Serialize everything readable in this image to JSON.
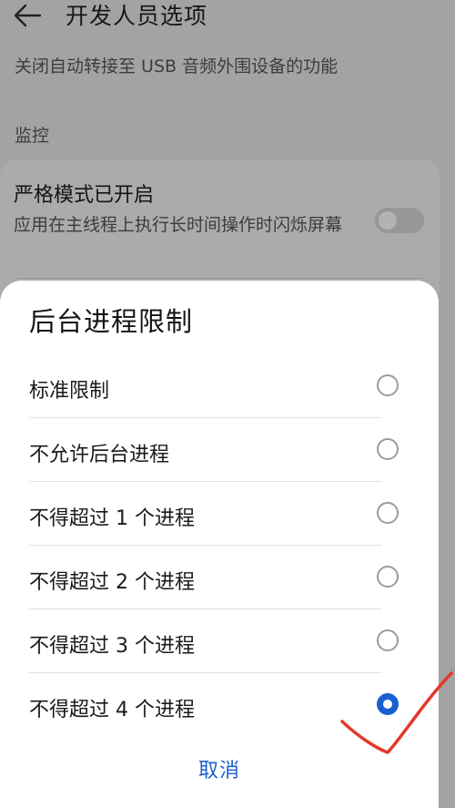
{
  "header": {
    "title": "开发人员选项",
    "back_icon": "back-arrow-icon"
  },
  "background": {
    "usb_description": "关闭自动转接至 USB 音频外围设备的功能",
    "section_label": "监控",
    "strict_mode": {
      "title": "严格模式已开启",
      "description": "应用在主线程上执行长时间操作时闪烁屏幕",
      "toggle_on": false
    }
  },
  "dialog": {
    "title": "后台进程限制",
    "options": [
      {
        "label": "标准限制",
        "selected": false
      },
      {
        "label": "不允许后台进程",
        "selected": false
      },
      {
        "label": "不得超过 1 个进程",
        "selected": false
      },
      {
        "label": "不得超过 2 个进程",
        "selected": false
      },
      {
        "label": "不得超过 3 个进程",
        "selected": false
      },
      {
        "label": "不得超过 4 个进程",
        "selected": true
      }
    ],
    "cancel_label": "取消"
  },
  "colors": {
    "accent": "#1a5fd1",
    "annotation": "#e03a2a",
    "overlay": "#a3a3a3"
  }
}
